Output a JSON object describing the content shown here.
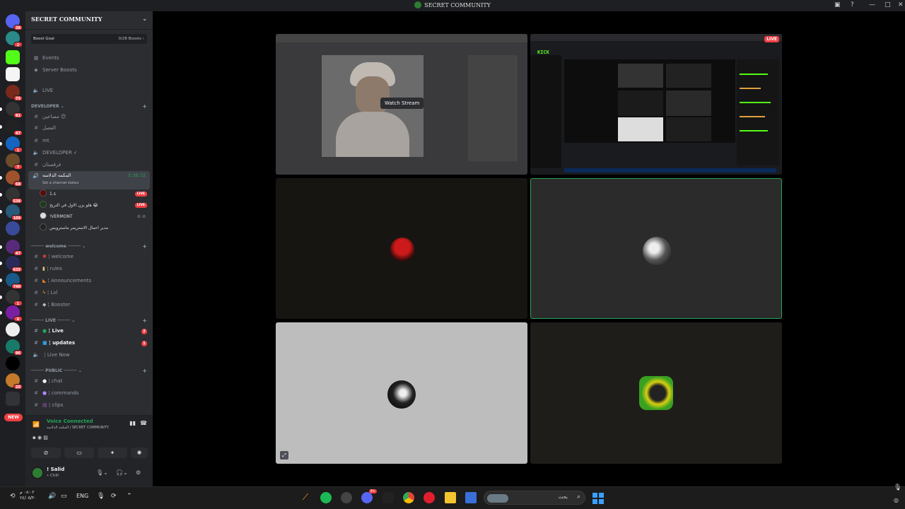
{
  "window": {
    "title": "SECRET COMMUNITY"
  },
  "rail": {
    "servers": [
      {
        "badge": "38"
      },
      {
        "badge": "2"
      },
      {
        "badge": ""
      },
      {
        "badge": ""
      },
      {
        "badge": "75"
      },
      {
        "badge": "91"
      },
      {
        "badge": "47"
      },
      {
        "badge": "1"
      },
      {
        "badge": "7"
      },
      {
        "badge": "68"
      },
      {
        "badge": "538"
      },
      {
        "badge": "109"
      },
      {
        "badge": ""
      },
      {
        "badge": "47"
      },
      {
        "badge": "635"
      },
      {
        "badge": "740"
      },
      {
        "badge": "1"
      },
      {
        "badge": "6"
      },
      {
        "badge": ""
      },
      {
        "badge": "96"
      },
      {
        "badge": ""
      },
      {
        "badge": "20"
      }
    ],
    "new_label": "NEW"
  },
  "sidebar": {
    "server_name": "SECRET COMMUNITY",
    "boost_goal": "Boost Goal",
    "boost_count": "0/28 Boosts",
    "events": "Events",
    "server_boosts": "Server Boosts",
    "live_channel": "LIVE",
    "cat_developer": "DEVELOPER",
    "ch_dev1": "مساعين 😊",
    "ch_dev2": "الفصل",
    "ch_dev3": "mt",
    "ch_dev4": "DEVELOPER ✓",
    "ch_dev5": "فرقستان",
    "voice_active_name": "المكمه الدلاسه",
    "voice_active_time": "3:36:32",
    "voice_active_status": "Set a channel status",
    "voice_users": [
      {
        "name": "1.s",
        "live": "LIVE"
      },
      {
        "name": "هلو يزن الاول في التريخ 😂",
        "live": "LIVE"
      },
      {
        "name": "!VERMONT",
        "live": ""
      },
      {
        "name": "مدير اعمال الاستريمر ماسترويس",
        "live": ""
      }
    ],
    "cat_welcome": "welcome",
    "ch_welcome": "welcome",
    "ch_rules": "rules",
    "ch_announcements": "Announcements",
    "ch_lvl": "Lvl",
    "ch_booster": "Booster",
    "cat_live": "LIVE",
    "ch_live": "Live",
    "ch_live_badge": "2",
    "ch_updates": "updates",
    "ch_updates_badge": "1",
    "ch_livenow": "Live Now",
    "cat_public": "PUBLIC",
    "ch_chat": "chat",
    "ch_commands": "commands",
    "ch_clips": "clips"
  },
  "voice_panel": {
    "status": "Voice Connected",
    "location": "المكمه الدلاسه / SECRET COMMUNITY"
  },
  "user": {
    "name": "! Salid",
    "status": "• Chill"
  },
  "stage": {
    "watch_stream": "Watch Stream",
    "live_tag": "LIVE"
  },
  "taskbar": {
    "lang": "ENG",
    "time": "٠٨:٠٢ م",
    "date": "٢٤/٠٥/٣٠",
    "search_placeholder": "بحث",
    "discord_badge": "9+"
  },
  "colors": {
    "accent_green": "#23a55a",
    "live_red": "#f23f43",
    "sidebar_bg": "#2b2d31",
    "rail_bg": "#1e1f22"
  }
}
